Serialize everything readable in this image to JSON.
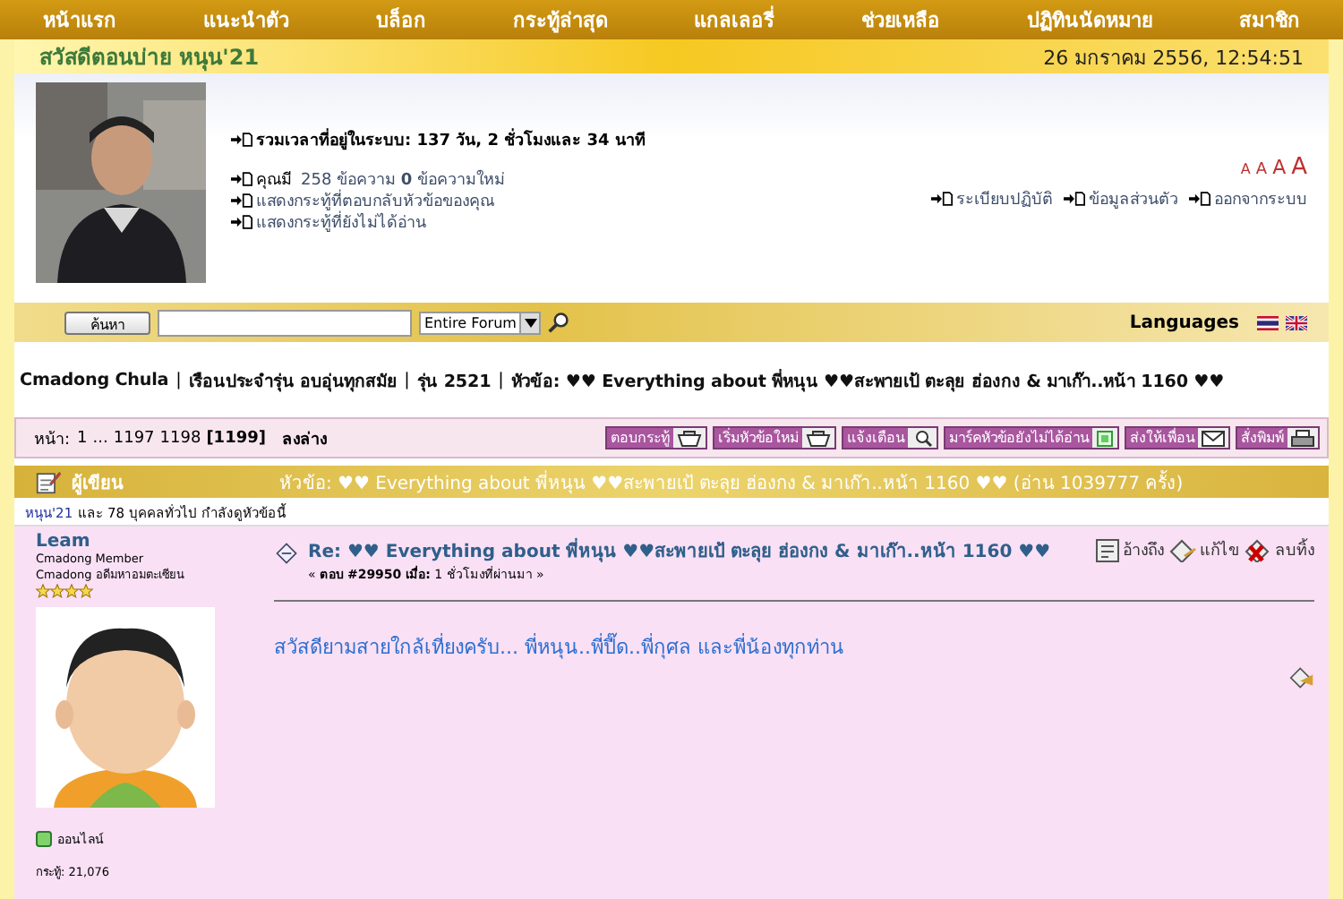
{
  "nav": [
    "หน้าแรก",
    "แนะนำตัว",
    "บล็อก",
    "กระทู้ล่าสุด",
    "แกลเลอรี่",
    "ช่วยเหลือ",
    "ปฏิทินนัดหมาย",
    "สมาชิก"
  ],
  "greeting": "สวัสดีตอนบ่าย หนุน'21",
  "datetime": "26 มกราคม 2556, 12:54:51",
  "user_panel": {
    "avatar": {
      "kind": "picture"
    },
    "online_time": "รวมเวลาที่อยู่ในระบบ: 137 วัน, 2 ชั่วโมงและ 34 นาที",
    "messages_label": "คุณมี",
    "messages_link": "258 ข้อความ **0** ข้อความใหม่",
    "links": [
      "แสดงกระทู้ที่ตอบกลับหัวข้อของคุณ",
      "แสดงกระทู้ที่ยังไม่ได้อ่าน"
    ],
    "font_sizes": [
      "A",
      "A",
      "A",
      "A"
    ],
    "account_links": [
      "ระเบียบปฏิบัติ",
      "ข้อมูลส่วนตัว",
      "ออกจากระบบ"
    ]
  },
  "search": {
    "button": "ค้นหา",
    "scope": "Entire Forum",
    "languages_label": "Languages"
  },
  "breadcrumb_separator": "|",
  "breadcrumb": [
    "Cmadong Chula",
    "เรือนประจำรุ่น อบอุ่นทุกสมัย",
    "รุ่น 2521",
    "หัวข้อ: ♥♥ Everything about พี่หนุน ♥♥สะพายเป้ ตะลุย ฮ่องกง & มาเก๊า..หน้า 1160 ♥♥"
  ],
  "pagination": {
    "label": "หน้า:",
    "pages": [
      {
        "text": "1",
        "selected": false
      },
      {
        "text": "...",
        "selected": false
      },
      {
        "text": "1197",
        "selected": false
      },
      {
        "text": "1198",
        "selected": false
      },
      {
        "text": "[1199]",
        "selected": true
      }
    ],
    "go_down": "ลงล่าง"
  },
  "toolbar": [
    {
      "label": "ตอบกระทู้",
      "kind": "reply"
    },
    {
      "label": "เริ่มหัวข้อใหม่",
      "kind": "reply"
    },
    {
      "label": "แจ้งเตือน",
      "kind": "notify"
    },
    {
      "label": "มาร์คหัวข้อยังไม่ได้อ่าน",
      "kind": "mark"
    },
    {
      "label": "ส่งให้เพื่อน",
      "kind": "send"
    },
    {
      "label": "สั่งพิมพ์",
      "kind": "print"
    }
  ],
  "topic_header": {
    "author_label": "ผู้เขียน",
    "title": "หัวข้อ: ♥♥ Everything about พี่หนุน ♥♥สะพายเป้ ตะลุย ฮ่องกง & มาเก๊า..หน้า 1160 ♥♥  (อ่าน 1039777 ครั้ง)"
  },
  "viewers": {
    "member": "หนุน'21",
    "rest": "และ 78 บุคคลทั่วไป กำลังดูหัวข้อนี้"
  },
  "post": {
    "author": "Leam",
    "rank": "Cmadong Member",
    "title": "Cmadong อดีมหาอมตะเซียน",
    "stars": 4,
    "avatar": {
      "kind": "picture"
    },
    "online": "ออนไลน์",
    "post_count": "กระทู้: 21,076",
    "subject": "Re: ♥♥ Everything about พี่หนุน ♥♥สะพายเป้ ตะลุย ฮ่องกง & มาเก๊า..หน้า 1160 ♥♥",
    "meta": "« **ตอบ #29950 เมื่อ:** 1 ชั่วโมงที่ผ่านมา »",
    "actions": [
      {
        "label": "อ้างถึง",
        "kind": "quote"
      },
      {
        "label": "แก้ไข",
        "kind": "edit"
      },
      {
        "label": "ลบทิ้ง",
        "kind": "delete"
      }
    ],
    "body": "สวัสดียามสายใกล้เที่ยงครับ... พี่หนุน..พี่ปี๊ด..พี่กุศล และพี่น้องทุกท่าน"
  }
}
